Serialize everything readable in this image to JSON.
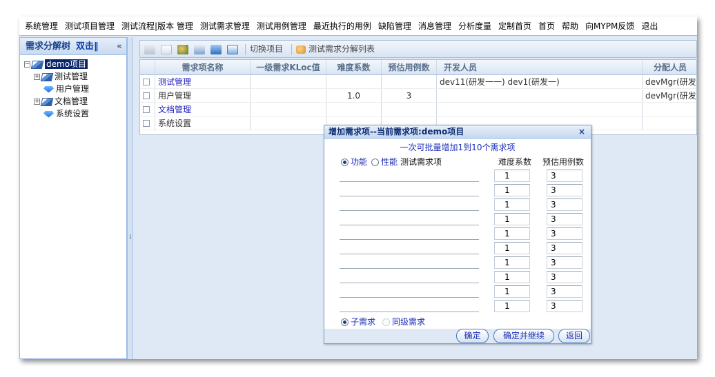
{
  "menu": [
    "系统管理",
    "测试项目管理",
    "测试流程|版本 管理",
    "测试需求管理",
    "测试用例管理",
    "最近执行的用例",
    "缺陷管理",
    "消息管理",
    "分析度量",
    "定制首页",
    "首页",
    "帮助",
    "向MYPM反馈",
    "退出"
  ],
  "left_panel": {
    "title": "需求分解树",
    "title2": "双击‖",
    "collapse": "«",
    "tree": {
      "root": "demo项目",
      "children": [
        "测试管理",
        "用户管理",
        "文档管理",
        "系统设置"
      ]
    }
  },
  "toolbar": {
    "switch_project": "切换项目",
    "req_list": "测试需求分解列表"
  },
  "grid": {
    "columns": [
      "需求项名称",
      "一级需求KLoc值",
      "难度系数",
      "预估用例数",
      "开发人员",
      "分配人员"
    ],
    "rows": [
      {
        "name": "测试管理",
        "kloc": "",
        "difficulty": "",
        "estimate": "",
        "dev": "dev11(研发一一) dev1(研发一)",
        "assign": "devMgr(研发经"
      },
      {
        "name": "用户管理",
        "kloc": "",
        "difficulty": "1.0",
        "estimate": "3",
        "dev": "",
        "assign": "devMgr(研发经"
      },
      {
        "name": "文档管理",
        "kloc": "",
        "difficulty": "",
        "estimate": "",
        "dev": "",
        "assign": ""
      },
      {
        "name": "系统设置",
        "kloc": "",
        "difficulty": "",
        "estimate": "",
        "dev": "",
        "assign": ""
      }
    ]
  },
  "dialog": {
    "title": "增加需求项--当前需求项:demo项目",
    "close": "×",
    "batch_note": "一次可批量增加1到10个需求项",
    "type_function": "功能",
    "type_performance": "性能",
    "name_label": "测试需求项",
    "difficulty_label": "难度系数",
    "estimate_label": "预估用例数",
    "inputs": [
      {
        "name": "",
        "difficulty": "1",
        "estimate": "3"
      },
      {
        "name": "",
        "difficulty": "1",
        "estimate": "3"
      },
      {
        "name": "",
        "difficulty": "1",
        "estimate": "3"
      },
      {
        "name": "",
        "difficulty": "1",
        "estimate": "3"
      },
      {
        "name": "",
        "difficulty": "1",
        "estimate": "3"
      },
      {
        "name": "",
        "difficulty": "1",
        "estimate": "3"
      },
      {
        "name": "",
        "difficulty": "1",
        "estimate": "3"
      },
      {
        "name": "",
        "difficulty": "1",
        "estimate": "3"
      },
      {
        "name": "",
        "difficulty": "1",
        "estimate": "3"
      },
      {
        "name": "",
        "difficulty": "1",
        "estimate": "3"
      }
    ],
    "child_req": "子需求",
    "sibling_req": "同级需求",
    "btn_ok": "确定",
    "btn_ok_continue": "确定并继续",
    "btn_back": "返回"
  }
}
